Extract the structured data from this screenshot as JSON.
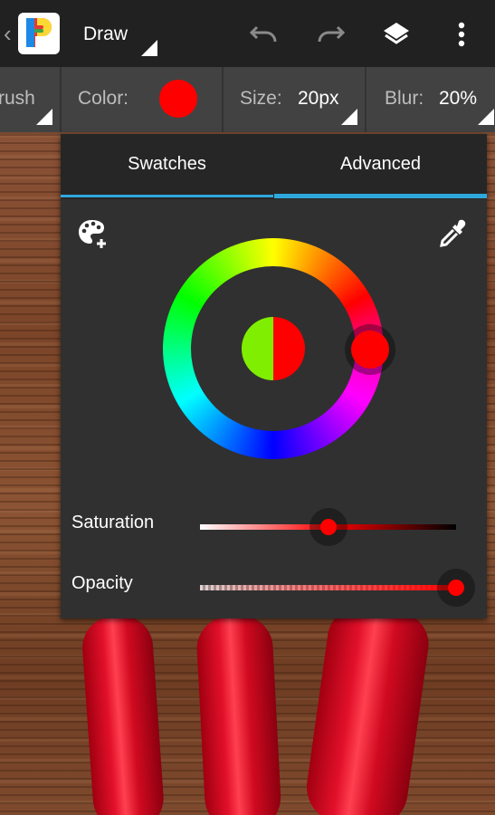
{
  "app": {
    "mode_title": "Draw",
    "icons": {
      "back": "chevron-left-icon",
      "logo": "photoshop-touch-icon",
      "undo": "undo-icon",
      "redo": "redo-icon",
      "layers": "layers-icon",
      "menu": "overflow-menu-icon"
    }
  },
  "toolbar": {
    "brush_label": "rush",
    "color_label": "Color:",
    "size_label": "Size:",
    "size_value": "20px",
    "blur_label": "Blur:",
    "blur_value": "20%",
    "current_color": "#ff0000"
  },
  "color_panel": {
    "tabs": [
      {
        "label": "Swatches",
        "active": false
      },
      {
        "label": "Advanced",
        "active": true
      }
    ],
    "accent_color": "#2ea8dc",
    "icons": {
      "add_swatch": "palette-add-icon",
      "eyedropper": "eyedropper-icon"
    },
    "preview": {
      "previous_color": "#80ee00",
      "new_color": "#ff0000"
    },
    "hue_handle_color": "#ff0000",
    "sliders": {
      "saturation": {
        "label": "Saturation",
        "value_fraction": 0.5
      },
      "opacity": {
        "label": "Opacity",
        "value_fraction": 1.0
      }
    }
  }
}
